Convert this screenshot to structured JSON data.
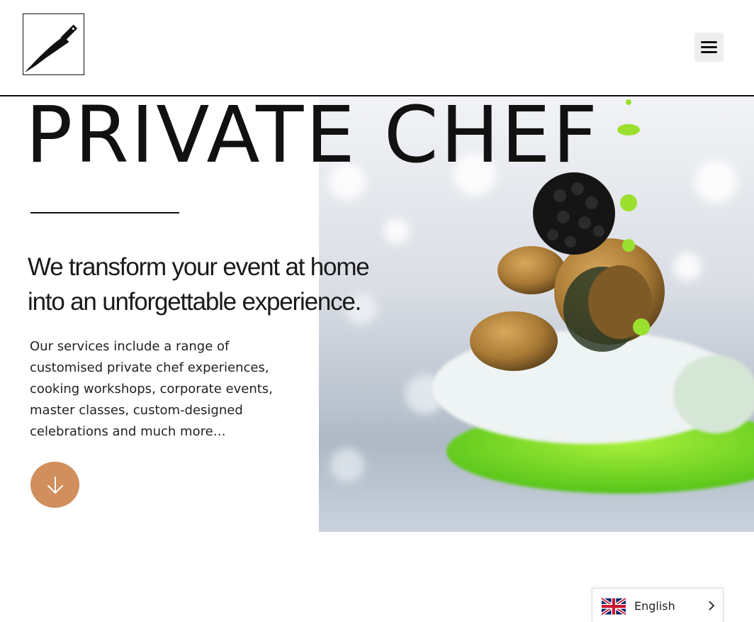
{
  "header": {
    "logo": "chef-knife-logo",
    "menu_icon": "hamburger-menu-icon"
  },
  "hero": {
    "title": "PRIVATE CHEF",
    "subheading_line1": "We transform your event at home",
    "subheading_line2": "into an unforgettable experience.",
    "description": "Our services include a range of customised private chef experiences, cooking workshops, corporate events, master classes, custom-designed celebrations and much more…",
    "scroll_icon": "arrow-down-icon",
    "image": "gourmet-mussels-caviar-dish-photo"
  },
  "language_switcher": {
    "flag": "uk-flag-icon",
    "label": "English",
    "chevron": "chevron-right-icon"
  },
  "colors": {
    "accent": "#d08f5c",
    "text": "#111111",
    "background": "#ffffff"
  }
}
